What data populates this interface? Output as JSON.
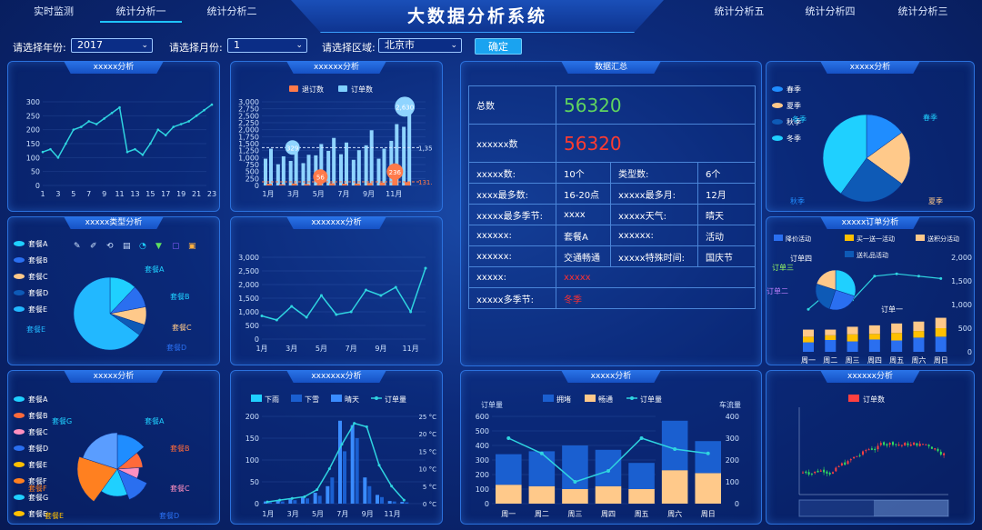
{
  "nav": {
    "left": [
      "实时监测",
      "统计分析一",
      "统计分析二"
    ],
    "right": [
      "统计分析五",
      "统计分析四",
      "统计分析三"
    ],
    "title": "大数据分析系统"
  },
  "filters": {
    "year_label": "请选择年份:",
    "year_value": "2017",
    "month_label": "请选择月份:",
    "month_value": "1",
    "area_label": "请选择区域:",
    "area_value": "北京市",
    "confirm": "确定"
  },
  "panels": {
    "p1": "xxxxx分析",
    "p2": "xxxxxx分析",
    "p3": "数据汇总",
    "p4": "xxxxx分析",
    "p5": "xxxxx类型分析",
    "p6": "xxxxxxx分析",
    "p7": "xxxxx订单分析",
    "p8": "xxxxx分析",
    "p9": "xxxxxxx分析",
    "p10": "xxxxx分析",
    "p11": "xxxxxx分析"
  },
  "summary": {
    "total_label": "总数",
    "total_value": "56320",
    "count_label": "xxxxxx数",
    "count_value": "56320",
    "rows": [
      [
        "xxxxx数:",
        "10个",
        "类型数:",
        "6个"
      ],
      [
        "xxxx最多数:",
        "16-20点",
        "xxxxx最多月:",
        "12月"
      ],
      [
        "xxxxx最多季节:",
        "xxxx",
        "xxxxx天气:",
        "晴天"
      ],
      [
        "xxxxxx:",
        "套餐A",
        "xxxxxx:",
        "活动"
      ],
      [
        "xxxxxx:",
        "交通畅通",
        "xxxxx特殊时间:",
        "国庆节"
      ]
    ],
    "row_red1_label": "xxxxx:",
    "row_red1_value": "xxxxx",
    "row_red2_label": "xxxxx多季节:",
    "row_red2_value": "冬季"
  },
  "chart_data": [
    {
      "type": "line",
      "title": "xxxxx分析",
      "x": [
        1,
        2,
        3,
        4,
        5,
        6,
        7,
        8,
        9,
        10,
        11,
        12,
        13,
        14,
        15,
        16,
        17,
        18,
        19,
        20,
        21,
        22,
        23
      ],
      "ylim": [
        0,
        300
      ],
      "yticks": [
        0,
        50,
        100,
        150,
        200,
        250,
        300
      ],
      "xticks": [
        1,
        3,
        5,
        7,
        9,
        11,
        13,
        15,
        17,
        19,
        21,
        23
      ],
      "values": [
        120,
        130,
        100,
        150,
        200,
        210,
        230,
        220,
        240,
        260,
        280,
        120,
        130,
        110,
        150,
        200,
        180,
        210,
        220,
        230,
        250,
        270,
        290
      ]
    },
    {
      "type": "bar",
      "title": "xxxxxx分析",
      "categories": [
        "1月",
        "2月",
        "3月",
        "4月",
        "5月",
        "6月",
        "7月",
        "8月",
        "9月",
        "10月",
        "11月",
        "12月"
      ],
      "legend": [
        "退订数",
        "订单数"
      ],
      "ylim": [
        0,
        3000
      ],
      "yticks": [
        0,
        250,
        500,
        750,
        1000,
        1250,
        1500,
        1750,
        2000,
        2250,
        2500,
        2750,
        3000
      ],
      "xticks": [
        "1月",
        "3月",
        "5月",
        "7月",
        "9月",
        "11月"
      ],
      "series": [
        {
          "name": "订单数",
          "values": [
            1200,
            950,
            1100,
            1000,
            1350,
            1550,
            1400,
            1150,
            1800,
            1200,
            2000,
            2630
          ]
        },
        {
          "name": "退订数",
          "values": [
            60,
            40,
            70,
            50,
            56,
            80,
            60,
            70,
            90,
            100,
            236,
            120
          ]
        }
      ],
      "annotations": [
        "2,630",
        "329",
        "56",
        "236",
        "1,35",
        "131."
      ]
    },
    {
      "type": "pie",
      "title": "xxxxx分析 季节",
      "legend": [
        "春季",
        "夏季",
        "秋季",
        "冬季"
      ],
      "labels": [
        "春季",
        "夏季",
        "秋季",
        "冬季"
      ],
      "values": [
        15,
        20,
        25,
        40
      ]
    },
    {
      "type": "pie",
      "title": "xxxxx类型分析",
      "legend": [
        "套餐A",
        "套餐B",
        "套餐C",
        "套餐D",
        "套餐E"
      ],
      "labels": [
        "套餐A",
        "套餐B",
        "套餐C",
        "套餐D",
        "套餐E"
      ],
      "values": [
        12,
        10,
        8,
        5,
        65
      ]
    },
    {
      "type": "line",
      "title": "xxxxxxx分析",
      "x": [
        1,
        2,
        3,
        4,
        5,
        6,
        7,
        8,
        9,
        10,
        11,
        12
      ],
      "ylim": [
        0,
        3000
      ],
      "yticks": [
        0,
        500,
        1000,
        1500,
        2000,
        2500,
        3000
      ],
      "xticks": [
        "1月",
        "3月",
        "5月",
        "7月",
        "9月",
        "11月"
      ],
      "values": [
        850,
        700,
        1200,
        800,
        1600,
        900,
        1000,
        1800,
        1600,
        1900,
        1000,
        2600
      ]
    },
    {
      "type": "bar",
      "title": "xxxxx订单分析",
      "categories": [
        "周一",
        "周二",
        "周三",
        "周四",
        "周五",
        "周六",
        "周日"
      ],
      "legend": [
        "降价活动",
        "买一送一活动",
        "送积分活动",
        "送礼品活动"
      ],
      "ylim": [
        0,
        2000
      ],
      "yticks": [
        0,
        500,
        1000,
        1500,
        2000
      ],
      "pie_labels": [
        "订单一",
        "订单二",
        "订单三",
        "订单四"
      ],
      "series": [
        {
          "name": "降价活动",
          "values": [
            200,
            250,
            220,
            260,
            240,
            300,
            320
          ]
        },
        {
          "name": "买一送一活动",
          "values": [
            120,
            100,
            150,
            120,
            160,
            140,
            180
          ]
        },
        {
          "name": "送积分活动",
          "values": [
            150,
            120,
            160,
            180,
            200,
            200,
            220
          ]
        },
        {
          "name": "line",
          "values": [
            900,
            1300,
            1100,
            1600,
            1650,
            1600,
            1550
          ]
        }
      ]
    },
    {
      "type": "pie",
      "title": "xxxxx分析 套餐",
      "legend": [
        "套餐A",
        "套餐B",
        "套餐C",
        "套餐D",
        "套餐E",
        "套餐F",
        "套餐G",
        "套餐E"
      ],
      "labels": [
        "套餐A",
        "套餐B",
        "套餐C",
        "套餐D",
        "套餐E",
        "套餐F",
        "套餐G"
      ],
      "values": [
        14,
        10,
        8,
        12,
        16,
        20,
        20
      ]
    },
    {
      "type": "bar",
      "title": "xxxxxxx分析",
      "categories": [
        "1月",
        "2月",
        "3月",
        "4月",
        "5月",
        "6月",
        "7月",
        "8月",
        "9月",
        "10月",
        "11月",
        "12月"
      ],
      "legend": [
        "下雨",
        "下雪",
        "晴天",
        "订单量"
      ],
      "ylim": [
        0,
        200
      ],
      "yticks": [
        0,
        50,
        100,
        150,
        200
      ],
      "y2ticks": [
        "0 °C",
        "5 °C",
        "10 °C",
        "15 °C",
        "20 °C",
        "25 °C"
      ],
      "xticks": [
        "1月",
        "3月",
        "5月",
        "7月",
        "9月",
        "11月"
      ],
      "series": [
        {
          "name": "晴天",
          "values": [
            5,
            8,
            10,
            15,
            25,
            40,
            190,
            180,
            60,
            20,
            6,
            4
          ]
        },
        {
          "name": "下雨",
          "values": [
            3,
            5,
            8,
            12,
            18,
            60,
            120,
            150,
            40,
            15,
            5,
            3
          ]
        },
        {
          "name": "订单量",
          "values": [
            0.5,
            1,
            1.5,
            2,
            4,
            10,
            17,
            23,
            22,
            11,
            5,
            1
          ]
        }
      ]
    },
    {
      "type": "bar",
      "title": "xxxxx分析 交通",
      "categories": [
        "周一",
        "周二",
        "周三",
        "周四",
        "周五",
        "周六",
        "周日"
      ],
      "legend": [
        "拥堵",
        "畅通",
        "订单量"
      ],
      "ylabel": "订单量",
      "y2label": "车流量",
      "ylim": [
        0,
        600
      ],
      "yticks": [
        0,
        100,
        200,
        300,
        400,
        500,
        600
      ],
      "y2ticks": [
        0,
        100,
        200,
        300,
        400
      ],
      "series": [
        {
          "name": "拥堵",
          "values": [
            210,
            240,
            300,
            250,
            180,
            340,
            220
          ]
        },
        {
          "name": "畅通",
          "values": [
            130,
            120,
            100,
            120,
            100,
            230,
            210
          ]
        },
        {
          "name": "订单量",
          "values": [
            300,
            230,
            100,
            150,
            300,
            250,
            230
          ]
        }
      ]
    },
    {
      "type": "candlestick",
      "title": "xxxxxx分析",
      "legend": [
        "订单数"
      ],
      "ylim": [
        1200,
        2400
      ]
    }
  ]
}
